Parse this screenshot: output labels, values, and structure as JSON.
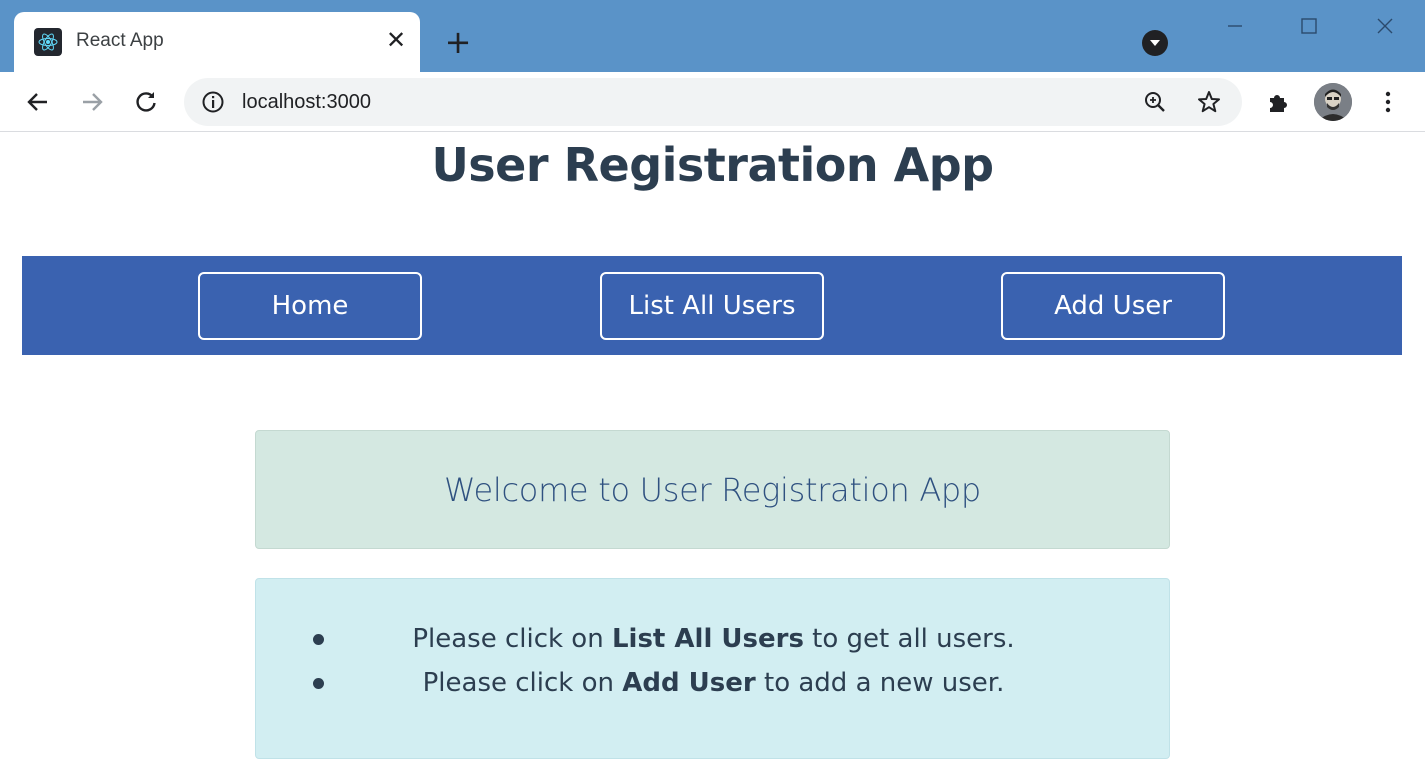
{
  "browser": {
    "tab_title": "React App",
    "tab_close": "✕",
    "new_tab": "+",
    "url": "localhost:3000",
    "window_controls": [
      "—",
      "☐",
      "✕"
    ]
  },
  "app": {
    "title": "User Registration App",
    "nav": [
      {
        "label": "Home"
      },
      {
        "label": "List All Users"
      },
      {
        "label": "Add User"
      }
    ],
    "welcome": "Welcome to User Registration App",
    "instructions": [
      {
        "prefix": "Please click on ",
        "bold": "List All Users",
        "suffix": " to get all users."
      },
      {
        "prefix": "Please click on ",
        "bold": "Add User",
        "suffix": " to add a new user."
      }
    ]
  },
  "colors": {
    "titlebar": "#5a93c8",
    "navbar": "#3a62b0",
    "welcome_bg": "#d4e8e1",
    "info_bg": "#d2eef2"
  },
  "icons": [
    "react-logo-icon",
    "close-icon",
    "plus-icon",
    "profile-dropdown-icon",
    "minimize-icon",
    "maximize-icon",
    "back-icon",
    "forward-icon",
    "reload-icon",
    "info-icon",
    "zoom-icon",
    "star-icon",
    "extensions-icon",
    "avatar",
    "menu-icon"
  ]
}
